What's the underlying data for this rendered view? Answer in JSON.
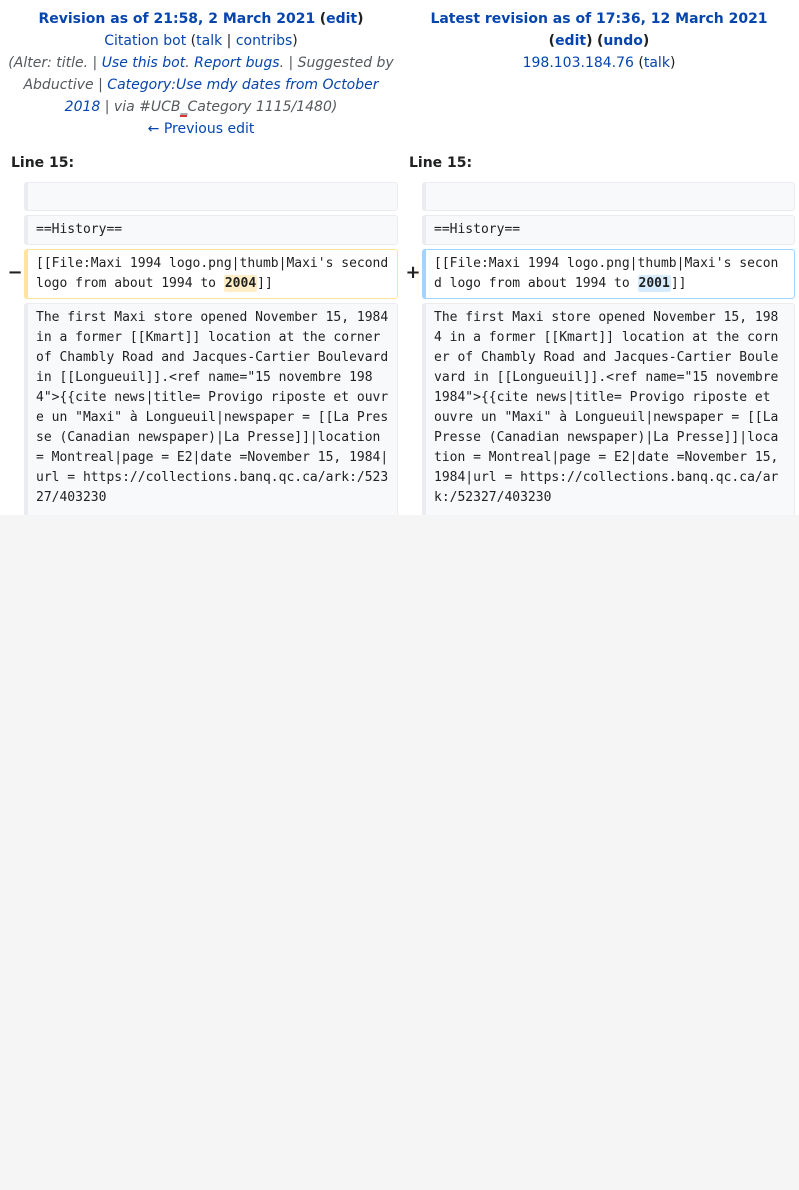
{
  "left_revision": {
    "title_text": "Revision as of 21:58, 2 March 2021",
    "edit_label": "edit",
    "user_name": "Citation bot",
    "talk_label": "talk",
    "sep": "|",
    "contribs_label": "contribs",
    "summary_alter": "(Alter: title. |",
    "summary_link1": "Use this bot",
    "summary_link2": "Report bugs",
    "summary_suggested": "| Suggested by Abductive |",
    "summary_category_link": "Category:Use mdy dates from October 2018",
    "summary_via": "| via #UCB",
    "summary_category_suffix": "Category 1115/1480)",
    "previous_edit_label": "← Previous edit"
  },
  "right_revision": {
    "title_text": "Latest revision as of 17:36, 12 March 2021",
    "edit_label": "edit",
    "undo_label": "undo",
    "user_ip": "198.103.184.76",
    "talk_label": "talk"
  },
  "diff": {
    "line_left": "Line 15:",
    "line_right": "Line 15:",
    "minus_marker": "−",
    "plus_marker": "+",
    "context_heading": "==History==",
    "changed_prefix": "[[File:Maxi 1994 logo.png|thumb|Maxi's second logo from about 1994 to ",
    "changed_old_value": "2004",
    "changed_new_value": "2001",
    "changed_suffix": "]]",
    "context_paragraph": "The first Maxi store opened November 15, 1984 in a former [[Kmart]] location at the corner of Chambly Road and Jacques-Cartier Boulevard in [[Longueuil]].<ref name=\"15 novembre 1984\">{{cite news|title= Provigo riposte et ouvre un \"Maxi\" à Longueuil|newspaper = [[La Presse (Canadian newspaper)|La Presse]]|location = Montreal|page = E2|date =November 15, 1984|url = https://collections.banq.qc.ca/ark:/52327/403230"
  }
}
